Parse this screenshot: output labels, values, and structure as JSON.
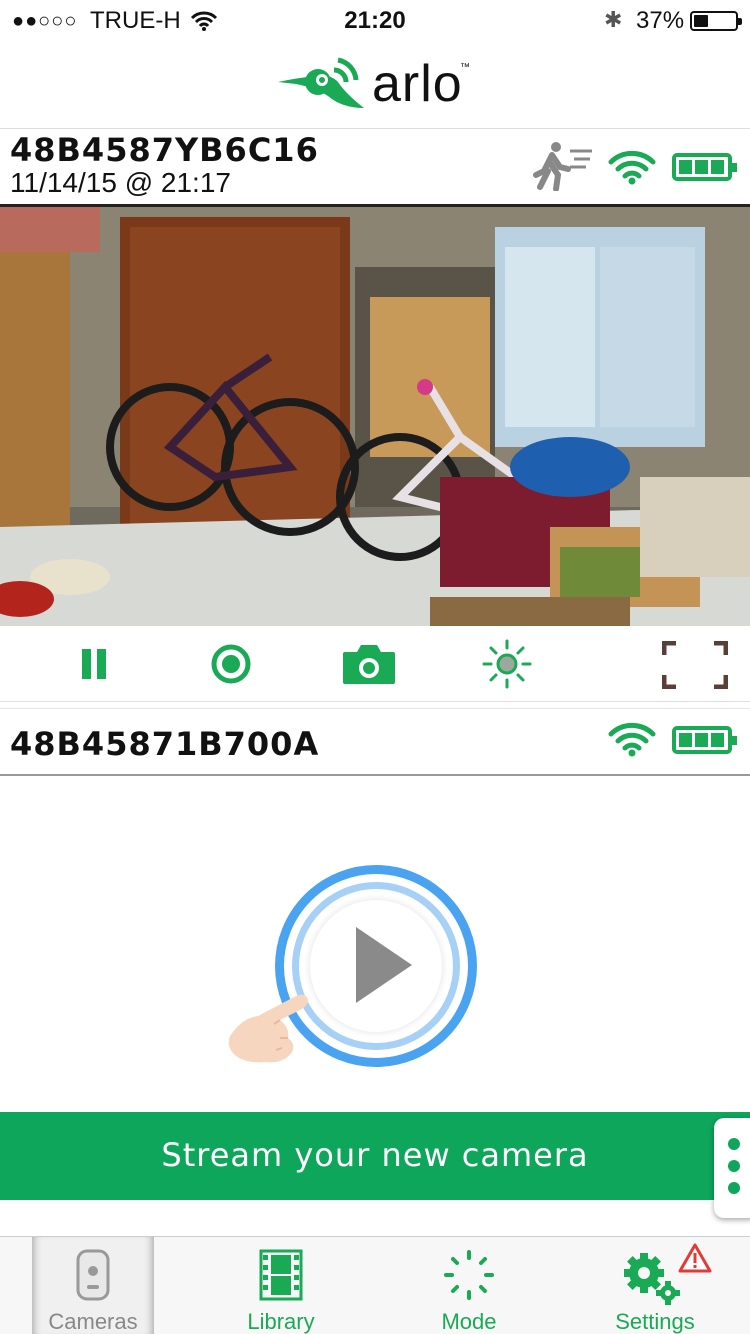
{
  "status_bar": {
    "signal": "●●○○○",
    "carrier": "TRUE-H",
    "time": "21:20",
    "bluetooth": "✱",
    "battery_percent": "37%"
  },
  "logo": {
    "text": "arlo",
    "tm": "™"
  },
  "cameras": [
    {
      "name": "48B4587YB6C16",
      "timestamp": "11/14/15 @ 21:17",
      "icons": [
        "motion-detected-icon",
        "wifi-icon",
        "battery-icon"
      ],
      "controls": [
        "pause-icon",
        "record-icon",
        "snapshot-icon",
        "brightness-icon",
        "fullscreen-icon"
      ]
    },
    {
      "name": "48B45871B700A",
      "icons": [
        "wifi-icon",
        "battery-icon"
      ],
      "cta": "Stream your new camera"
    }
  ],
  "tabs": [
    {
      "label": "Cameras",
      "icon": "camera-device-icon",
      "active": true
    },
    {
      "label": "Library",
      "icon": "film-icon",
      "active": false
    },
    {
      "label": "Mode",
      "icon": "mode-icon",
      "active": false
    },
    {
      "label": "Settings",
      "icon": "gears-icon",
      "active": false,
      "alert": "⚠"
    }
  ],
  "colors": {
    "accent": "#0ea65a",
    "play_ring": "#4aa3f0",
    "alert": "#e53935"
  }
}
